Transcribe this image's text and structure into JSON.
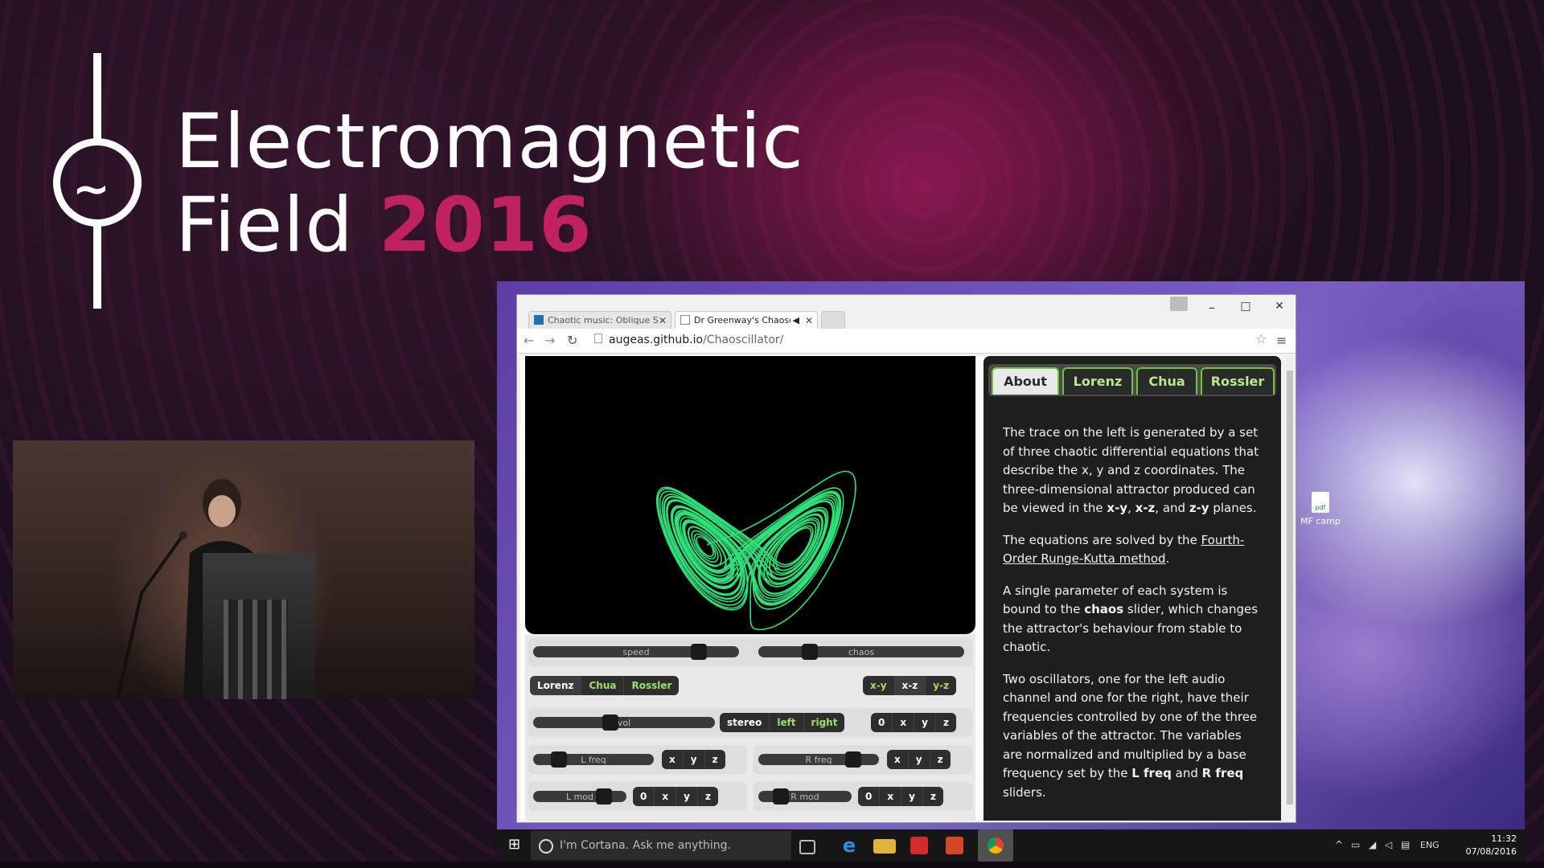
{
  "event": {
    "title_line1": "Electromagnetic",
    "title_line2": "Field",
    "year": "2016",
    "accent_color": "#c0215f"
  },
  "browser": {
    "tabs": [
      {
        "label": "Chaotic music: Oblique S",
        "icon": "linkedin-icon"
      },
      {
        "label": "Dr Greenway's Chaosc",
        "icon": "page-icon",
        "audio": "speaker-icon"
      }
    ],
    "url_host": "augeas.github.io",
    "url_path": "/Chaoscillator/",
    "window_controls": {
      "minimize": "–",
      "maximize": "□",
      "close": "✕"
    }
  },
  "app": {
    "sliders": {
      "speed": "speed",
      "chaos": "chaos",
      "vol": "vol",
      "lfreq": "L freq",
      "rfreq": "R freq",
      "lmod": "L mod",
      "rmod": "R mod"
    },
    "systems": [
      "Lorenz",
      "Chua",
      "Rossler"
    ],
    "selected_system": "Lorenz",
    "planes": [
      "x-y",
      "x-z",
      "y-z"
    ],
    "selected_plane": "x-z",
    "stereo": {
      "label": "stereo",
      "left": "left",
      "right": "right"
    },
    "axes0": [
      "0",
      "x",
      "y",
      "z"
    ],
    "axes": [
      "x",
      "y",
      "z"
    ],
    "trace_color": "#2fe07a",
    "slider_levels": {
      "speed": 0.8,
      "chaos": 0.25,
      "vol": 0.4,
      "lfreq": 0.25,
      "rfreq": 0.75,
      "lmod": 0.75,
      "rmod": 0.2
    }
  },
  "info": {
    "tabs": [
      "About",
      "Lorenz",
      "Chua",
      "Rossler"
    ],
    "active_tab": "About",
    "p1_a": "The trace on the left is generated by a set of three chaotic differential equations that describe the x, y and z coordinates. The three-dimensional attractor produced can be viewed in the ",
    "p1_xy": "x-y",
    "p1_comma": ", ",
    "p1_xz": "x-z",
    "p1_and": ", and ",
    "p1_zy": "z-y",
    "p1_end": " planes.",
    "p2_a": "The equations are solved by the ",
    "p2_link": "Fourth-Order Runge-Kutta method",
    "p2_end": ".",
    "p3_a": "A single parameter of each system is bound to the ",
    "p3_b": "chaos",
    "p3_end": " slider, which changes the attractor's behaviour from stable to chaotic.",
    "p4_a": "Two oscillators, one for the left audio channel and one for the right, have their frequencies controlled by one of the three variables of the attractor. The variables are normalized and multiplied by a base frequency set by the ",
    "p4_l": "L freq",
    "p4_and": " and ",
    "p4_r": "R freq",
    "p4_end": " sliders."
  },
  "desktop": {
    "icon_label": "MF camp",
    "icon_badge": "pdf"
  },
  "taskbar": {
    "search_placeholder": "I'm Cortana. Ask me anything.",
    "language": "ENG",
    "time": "11:32",
    "date": "07/08/2016"
  }
}
